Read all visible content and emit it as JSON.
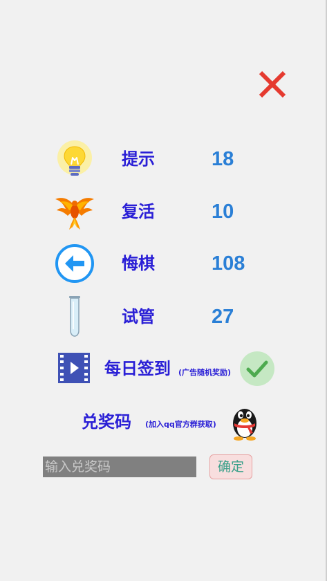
{
  "colors": {
    "background": "#f1f1f1",
    "label": "#2a1fd6",
    "count": "#2a7fd6",
    "close": "#e53a2f",
    "check_bg": "#c5e8c3",
    "check_mark": "#4daa4f",
    "input_bg": "#808080",
    "confirm_bg": "#f8dede",
    "confirm_text": "#3aa08a"
  },
  "close_button": {
    "icon": "close-icon"
  },
  "items": [
    {
      "icon": "lightbulb-icon",
      "label": "提示",
      "count": "18"
    },
    {
      "icon": "phoenix-icon",
      "label": "复活",
      "count": "10"
    },
    {
      "icon": "undo-arrow-icon",
      "label": "悔棋",
      "count": "108"
    },
    {
      "icon": "test-tube-icon",
      "label": "试管",
      "count": "27"
    }
  ],
  "daily_checkin": {
    "icon": "video-icon",
    "label": "每日签到",
    "hint": "(广告随机奖励)",
    "status_icon": "checkmark-icon"
  },
  "redeem": {
    "label": "兑奖码",
    "hint": "(加入qq官方群获取)",
    "icon": "qq-penguin-icon",
    "input_placeholder": "输入兑奖码",
    "input_value": "",
    "confirm_label": "确定"
  }
}
